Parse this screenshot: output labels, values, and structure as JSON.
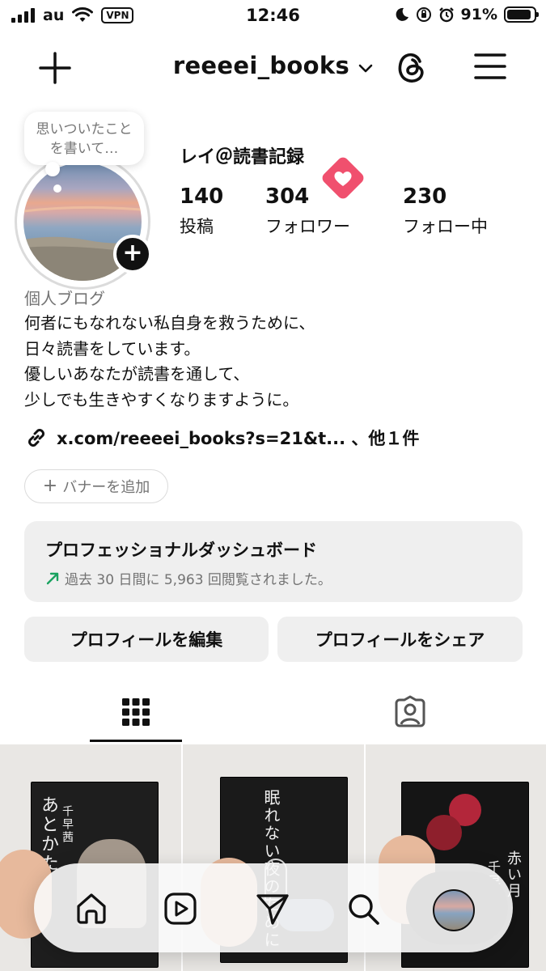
{
  "status_bar": {
    "carrier": "au",
    "vpn": "VPN",
    "time": "12:46",
    "battery_percent": "91%",
    "battery_level": 0.91
  },
  "header": {
    "username": "reeeei_books"
  },
  "profile": {
    "note": "思いついたことを書いて…",
    "display_name": "レイ＠読書記録",
    "stats": [
      {
        "value": "140",
        "label": "投稿"
      },
      {
        "value": "304",
        "label": "フォロワー"
      },
      {
        "value": "230",
        "label": "フォロー中"
      }
    ],
    "bio": {
      "category": "個人ブログ",
      "lines": [
        "何者にもなれない私自身を救うために、",
        "日々読書をしています。",
        "優しいあなたが読書を通して、",
        "少しでも生きやすくなりますように。"
      ]
    },
    "link": "x.com/reeeei_books?s=21&t... 、他１件",
    "add_banner": "バナーを追加"
  },
  "dashboard": {
    "title": "プロフェッショナルダッシュボード",
    "subtitle": "過去 30 日間に 5,963 回閲覧されました。"
  },
  "buttons": {
    "edit_profile": "プロフィールを編集",
    "share_profile": "プロフィールをシェア"
  },
  "posts": [
    {
      "title": "あとかた",
      "author": "千早茜"
    },
    {
      "title": "眠れない夜のために",
      "author": ""
    },
    {
      "title": "赤い月",
      "author": "千早茜"
    }
  ],
  "colors": {
    "accent_heart": "#f0506e",
    "trend_green": "#1aa260",
    "background": "#ffffff",
    "button_bg": "#efefef"
  },
  "icons": {
    "nav": [
      "home-icon",
      "reels-icon",
      "send-icon",
      "search-icon",
      "profile-avatar"
    ]
  }
}
